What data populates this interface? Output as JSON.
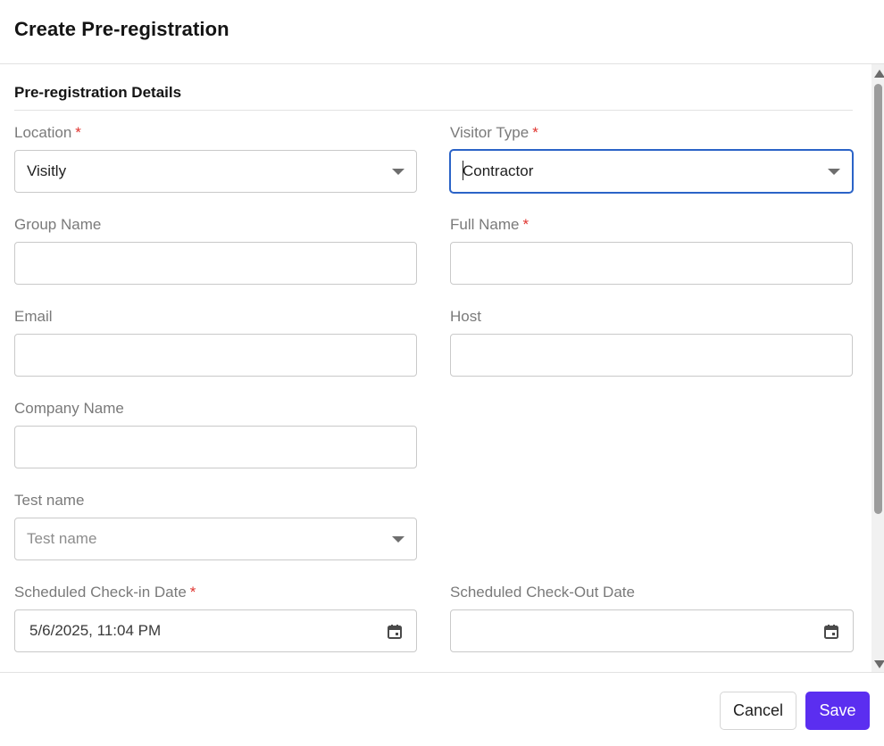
{
  "dialog": {
    "title": "Create Pre-registration"
  },
  "section": {
    "title": "Pre-registration Details"
  },
  "fields": {
    "location": {
      "label": "Location",
      "required_mark": "*",
      "value": "Visitly"
    },
    "visitor_type": {
      "label": "Visitor Type",
      "required_mark": "*",
      "value": "Contractor"
    },
    "group_name": {
      "label": "Group Name",
      "value": ""
    },
    "full_name": {
      "label": "Full Name",
      "required_mark": "*",
      "value": ""
    },
    "email": {
      "label": "Email",
      "value": ""
    },
    "host": {
      "label": "Host",
      "value": ""
    },
    "company_name": {
      "label": "Company Name",
      "value": ""
    },
    "test_name": {
      "label": "Test name",
      "placeholder": "Test name"
    },
    "checkin_date": {
      "label": "Scheduled Check-in Date",
      "required_mark": "*",
      "value": "5/6/2025, 11:04 PM"
    },
    "checkout_date": {
      "label": "Scheduled Check-Out Date",
      "value": ""
    }
  },
  "icons": {
    "dropdown": "chevron-down-icon",
    "calendar": "calendar-icon"
  },
  "footer": {
    "cancel_label": "Cancel",
    "save_label": "Save"
  },
  "colors": {
    "accent": "#5b2ef0",
    "focus": "#2b63c7",
    "required": "#e0342f"
  }
}
